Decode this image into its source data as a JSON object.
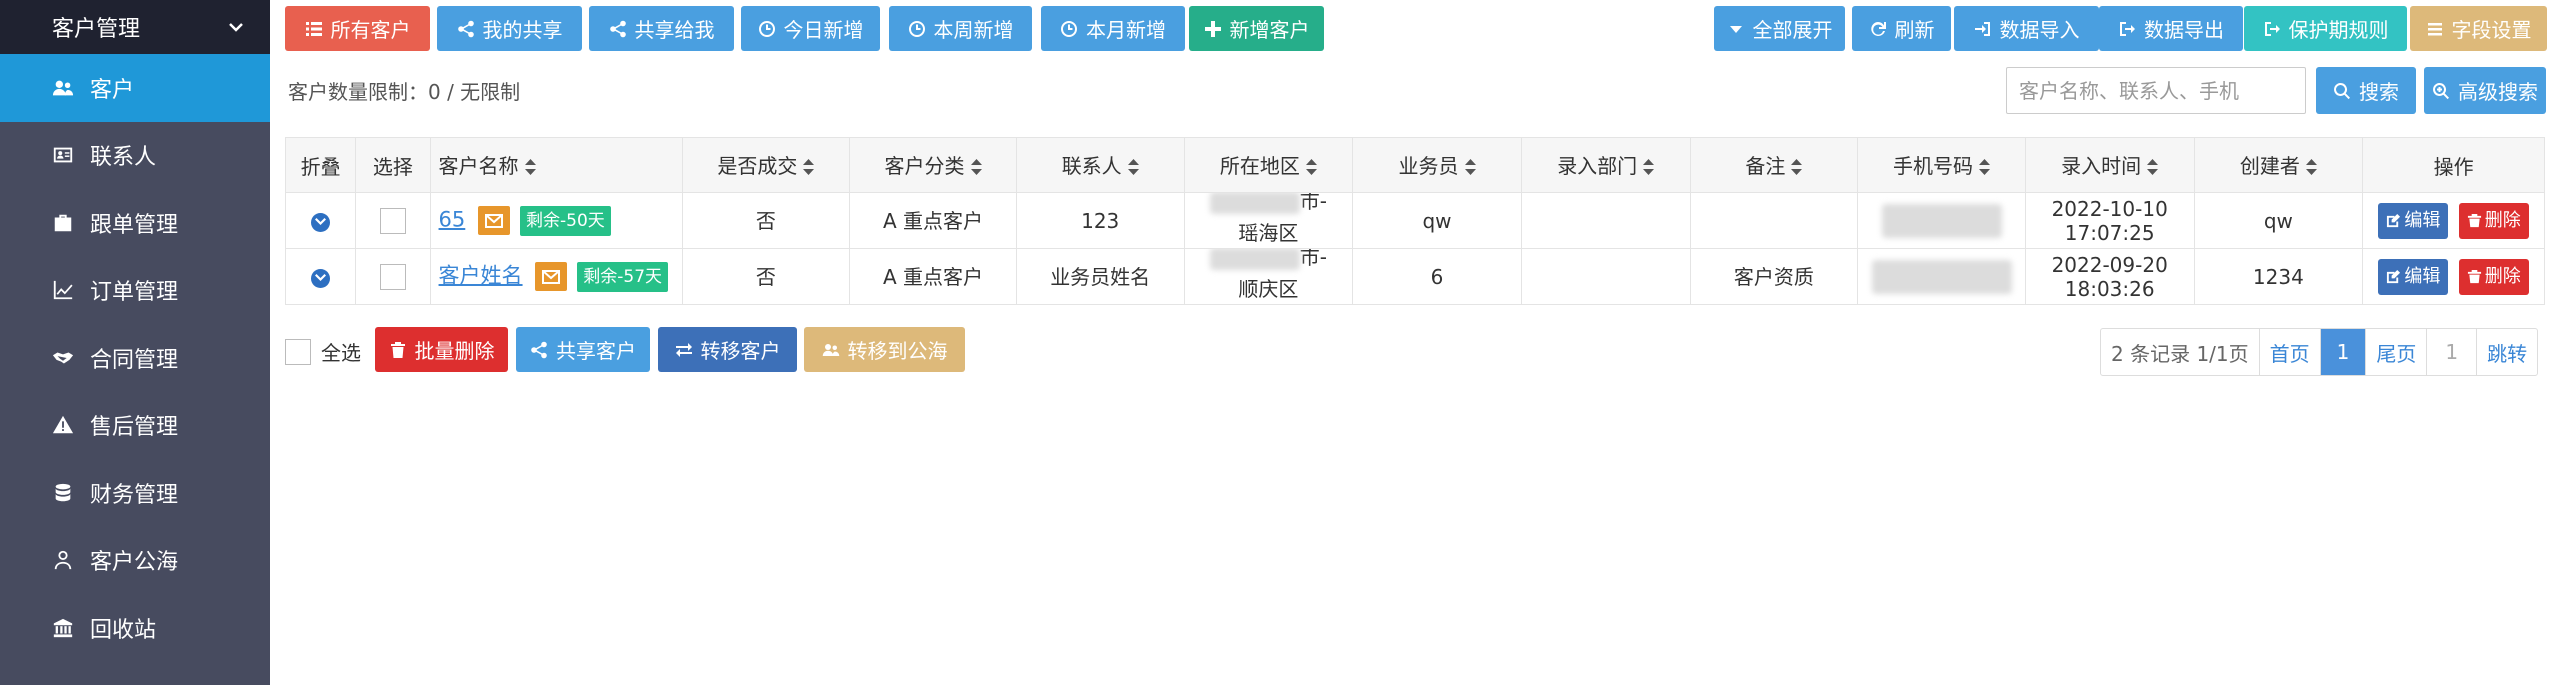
{
  "sidebar": {
    "header": "客户管理",
    "items": [
      {
        "label": "客户",
        "icon": "users-icon",
        "active": true
      },
      {
        "label": "联系人",
        "icon": "id-card-icon"
      },
      {
        "label": "跟单管理",
        "icon": "briefcase-icon"
      },
      {
        "label": "订单管理",
        "icon": "line-chart-icon"
      },
      {
        "label": "合同管理",
        "icon": "handshake-icon"
      },
      {
        "label": "售后管理",
        "icon": "warning-icon"
      },
      {
        "label": "财务管理",
        "icon": "database-icon"
      },
      {
        "label": "客户公海",
        "icon": "user-icon"
      },
      {
        "label": "回收站",
        "icon": "bank-icon"
      }
    ]
  },
  "toolbar": {
    "all_customers": "所有客户",
    "my_shared": "我的共享",
    "shared_to_me": "共享给我",
    "today_new": "今日新增",
    "week_new": "本周新增",
    "month_new": "本月新增",
    "add_customer": "新增客户",
    "expand_all": "全部展开",
    "refresh": "刷新",
    "import": "数据导入",
    "export": "数据导出",
    "protect_rule": "保护期规则",
    "field_settings": "字段设置"
  },
  "limit_text": "客户数量限制：0 / 无限制",
  "search": {
    "placeholder": "客户名称、联系人、手机",
    "search_label": "搜索",
    "advanced_label": "高级搜索"
  },
  "table": {
    "headers": {
      "fold": "折叠",
      "select": "选择",
      "name": "客户名称",
      "deal": "是否成交",
      "category": "客户分类",
      "contact": "联系人",
      "region": "所在地区",
      "salesman": "业务员",
      "dept": "录入部门",
      "remark": "备注",
      "phone": "手机号码",
      "entry_time": "录入时间",
      "creator": "创建者",
      "ops": "操作"
    },
    "rows": [
      {
        "name": "65",
        "remain": "剩余-50天",
        "deal": "否",
        "category": "A 重点客户",
        "contact": "123",
        "region_line1": "市-",
        "region_line2": "瑶海区",
        "salesman": "qw",
        "dept": "",
        "remark": "",
        "entry_date": "2022-10-10",
        "entry_clock": "17:07:25",
        "creator": "qw"
      },
      {
        "name": "客户姓名",
        "remain": "剩余-57天",
        "deal": "否",
        "category": "A 重点客户",
        "contact": "业务员姓名",
        "region_line1": "市-",
        "region_line2": "顺庆区",
        "salesman": "6",
        "dept": "",
        "remark": "客户资质",
        "entry_date": "2022-09-20",
        "entry_clock": "18:03:26",
        "creator": "1234"
      }
    ],
    "edit_label": "编辑",
    "delete_label": "删除"
  },
  "bottom": {
    "select_all": "全选",
    "batch_delete": "批量删除",
    "share": "共享客户",
    "transfer": "转移客户",
    "to_pool": "转移到公海"
  },
  "pager": {
    "summary": "2 条记录 1/1页",
    "first": "首页",
    "current": "1",
    "last": "尾页",
    "page_input": "1",
    "jump": "跳转"
  }
}
